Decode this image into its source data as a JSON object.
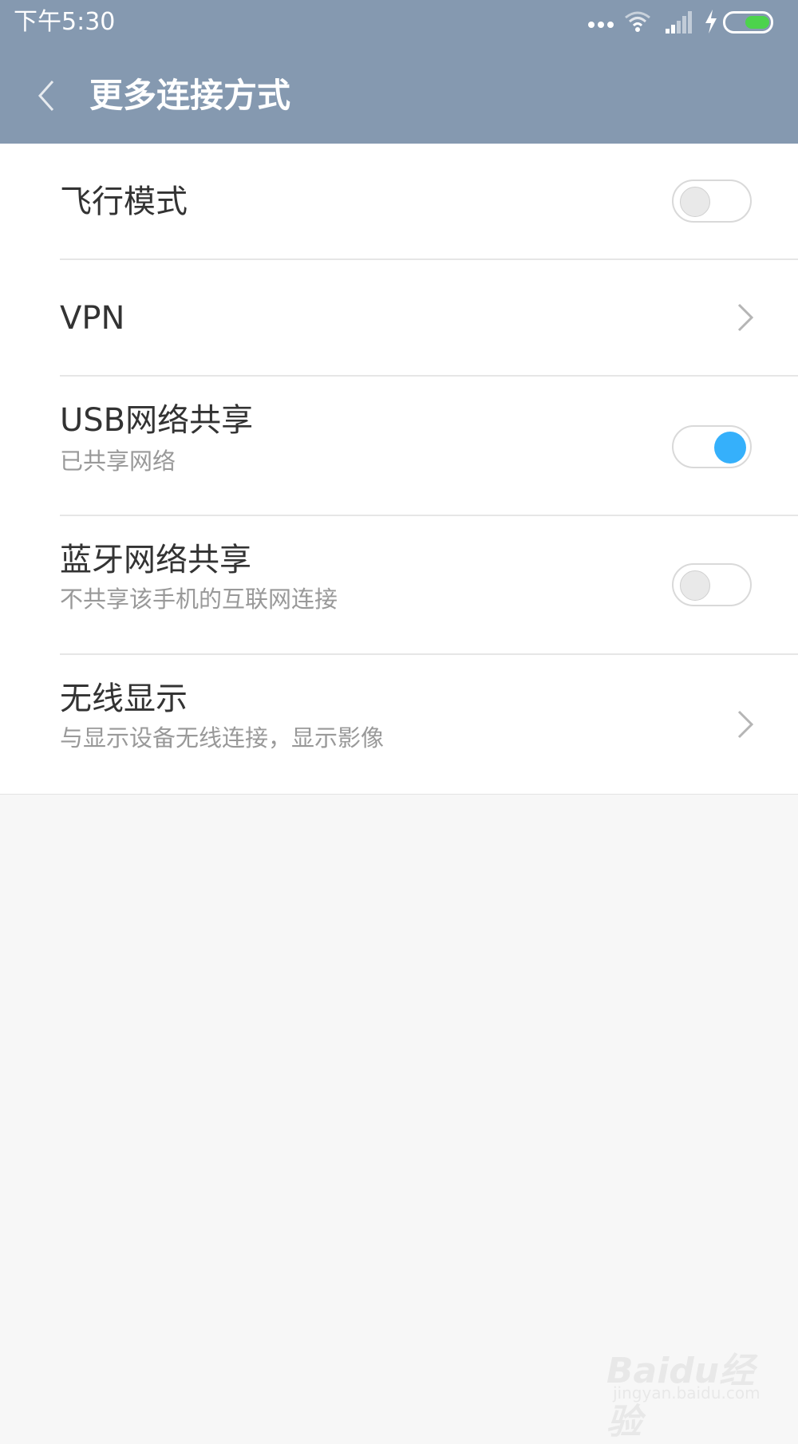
{
  "status_bar": {
    "time": "下午5:30",
    "icons": [
      "more-dots-icon",
      "wifi-icon",
      "signal-icon",
      "charging-bolt-icon",
      "battery-icon"
    ]
  },
  "header": {
    "title": "更多连接方式",
    "background": "#8599b0"
  },
  "settings": [
    {
      "title": "飞行模式",
      "type": "toggle",
      "enabled": false
    },
    {
      "title": "VPN",
      "type": "link"
    },
    {
      "title": "USB网络共享",
      "subtitle": "已共享网络",
      "type": "toggle",
      "enabled": true
    },
    {
      "title": "蓝牙网络共享",
      "subtitle": "不共享该手机的互联网连接",
      "type": "toggle",
      "enabled": false
    },
    {
      "title": "无线显示",
      "subtitle": "与显示设备无线连接，显示影像",
      "type": "link"
    }
  ],
  "colors": {
    "accent": "#35b0fb",
    "battery": "#4cd34c"
  },
  "watermark": {
    "brand": "Baidu经验",
    "url": "jingyan.baidu.com"
  }
}
